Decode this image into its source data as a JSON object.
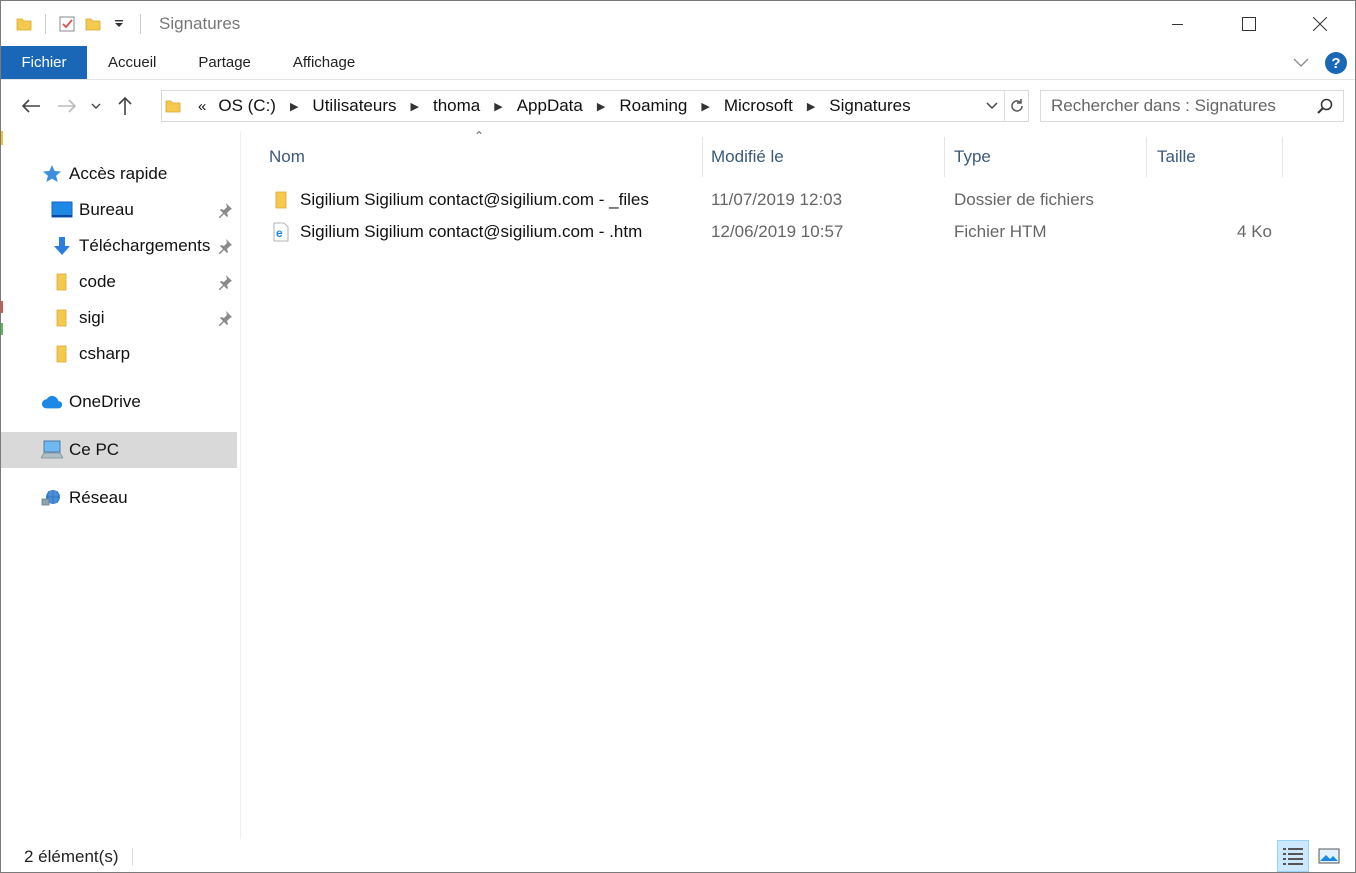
{
  "window": {
    "title": "Signatures"
  },
  "ribbon": {
    "tabs": [
      "Fichier",
      "Accueil",
      "Partage",
      "Affichage"
    ],
    "help_label": "?"
  },
  "navigation": {
    "breadcrumb_prefix": "«",
    "breadcrumbs": [
      "OS (C:)",
      "Utilisateurs",
      "thoma",
      "AppData",
      "Roaming",
      "Microsoft",
      "Signatures"
    ],
    "search_placeholder": "Rechercher dans : Signatures"
  },
  "sidebar": {
    "quick_access": "Accès rapide",
    "pinned": [
      {
        "label": "Bureau",
        "icon": "desktop-icon",
        "pinned": true
      },
      {
        "label": "Téléchargements",
        "icon": "download-icon",
        "pinned": true
      },
      {
        "label": "code",
        "icon": "folder-icon",
        "pinned": true
      },
      {
        "label": "sigi",
        "icon": "folder-icon",
        "pinned": true
      },
      {
        "label": "csharp",
        "icon": "folder-icon",
        "pinned": false
      }
    ],
    "onedrive": "OneDrive",
    "this_pc": "Ce PC",
    "network": "Réseau"
  },
  "file_list": {
    "columns": [
      "Nom",
      "Modifié le",
      "Type",
      "Taille"
    ],
    "rows": [
      {
        "name": "Sigilium Sigilium contact@sigilium.com - _files",
        "modified": "11/07/2019 12:03",
        "type": "Dossier de fichiers",
        "size": "",
        "icon": "folder-icon"
      },
      {
        "name": "Sigilium Sigilium contact@sigilium.com - .htm",
        "modified": "12/06/2019 10:57",
        "type": "Fichier HTM",
        "size": "4 Ko",
        "icon": "edge-html-icon"
      }
    ]
  },
  "status_bar": {
    "count": "2 élément(s)"
  },
  "colors": {
    "accent": "#1a67b8",
    "selection": "#d9d9d9",
    "folder": "#f5c94e",
    "header_text": "#3b5a7a"
  }
}
